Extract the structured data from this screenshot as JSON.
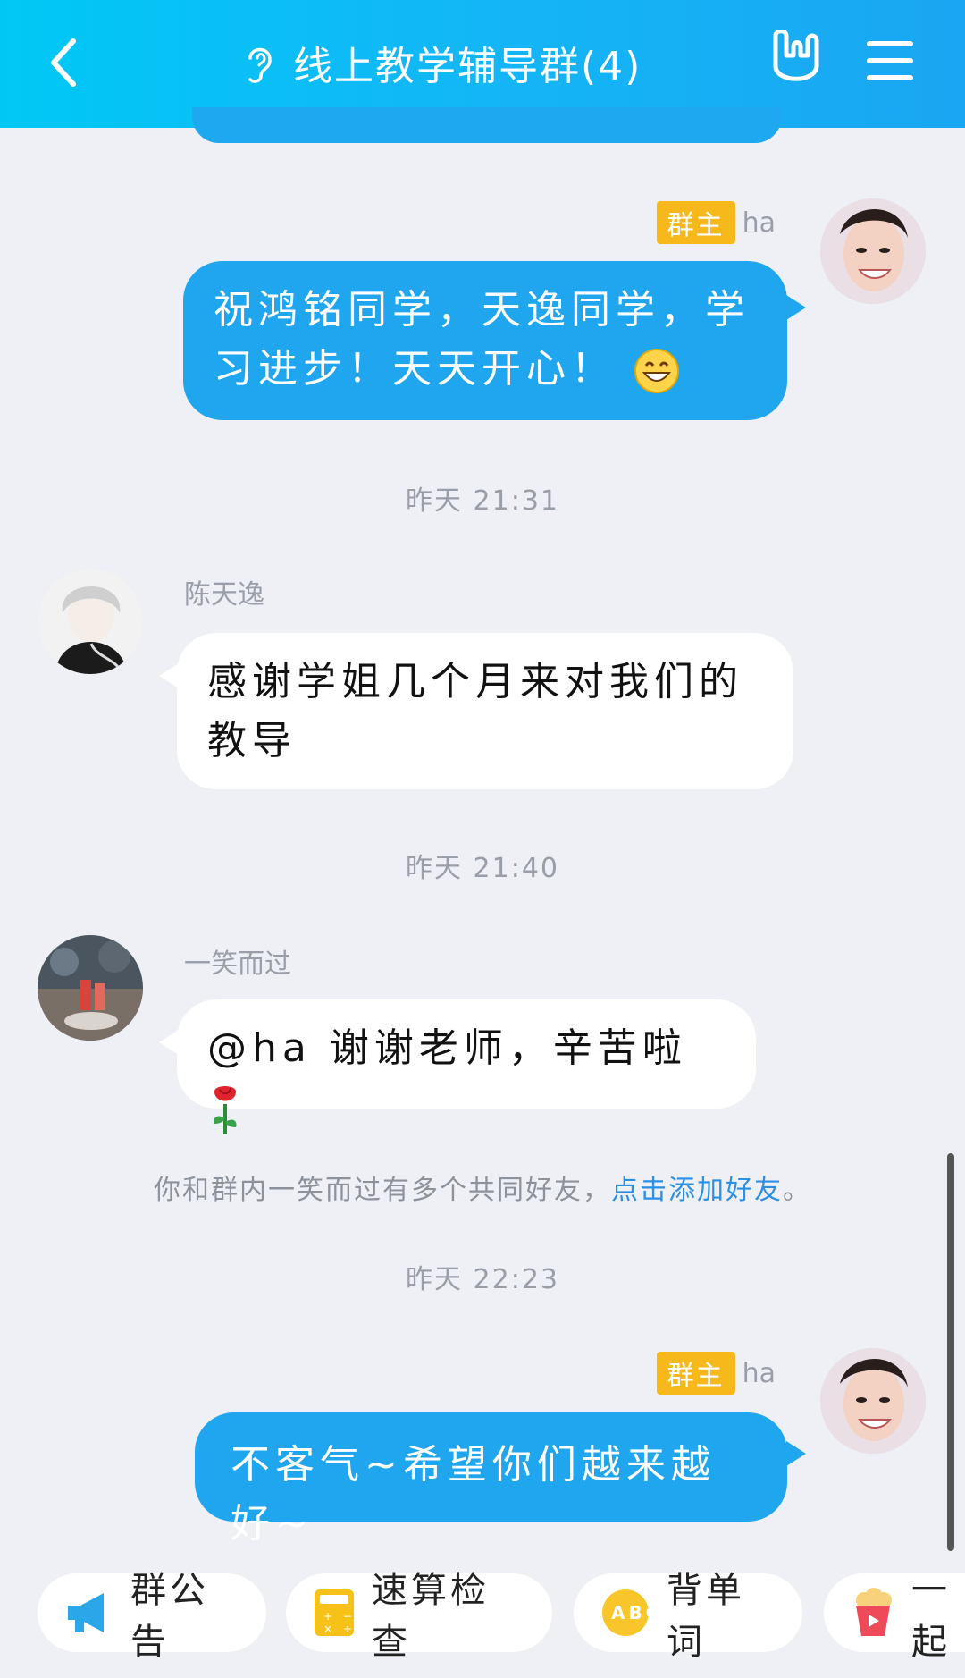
{
  "header": {
    "title": "线上教学辅导群(4)",
    "colors": {
      "start": "#00c8f5",
      "end": "#1aa6f2"
    }
  },
  "messages": [
    {
      "sender": "ha",
      "badge": "群主",
      "text_line1": "祝鸿铭同学，天逸同学，学",
      "text_line2": "习进步！天天开心！",
      "emoji": "grinning-face",
      "side": "right"
    },
    {
      "timestamp": "昨天 21:31"
    },
    {
      "sender": "陈天逸",
      "text_line1": "感谢学姐几个月来对我们的",
      "text_line2": "教导",
      "side": "left"
    },
    {
      "timestamp": "昨天 21:40"
    },
    {
      "sender": "一笑而过",
      "text": "@ha 谢谢老师，辛苦啦",
      "emoji": "rose",
      "side": "left"
    },
    {
      "system_text": "你和群内一笑而过有多个共同好友，",
      "system_link": "点击添加好友",
      "system_end": "。"
    },
    {
      "timestamp": "昨天 22:23"
    },
    {
      "sender": "ha",
      "badge": "群主",
      "text": "不客气~希望你们越来越好~",
      "side": "right"
    }
  ],
  "quick_bar": [
    {
      "label": "群公告",
      "icon": "megaphone-icon"
    },
    {
      "label": "速算检查",
      "icon": "calculator-icon"
    },
    {
      "label": "背单词",
      "icon": "abc-icon"
    },
    {
      "label": "一起",
      "icon": "popcorn-icon"
    }
  ]
}
